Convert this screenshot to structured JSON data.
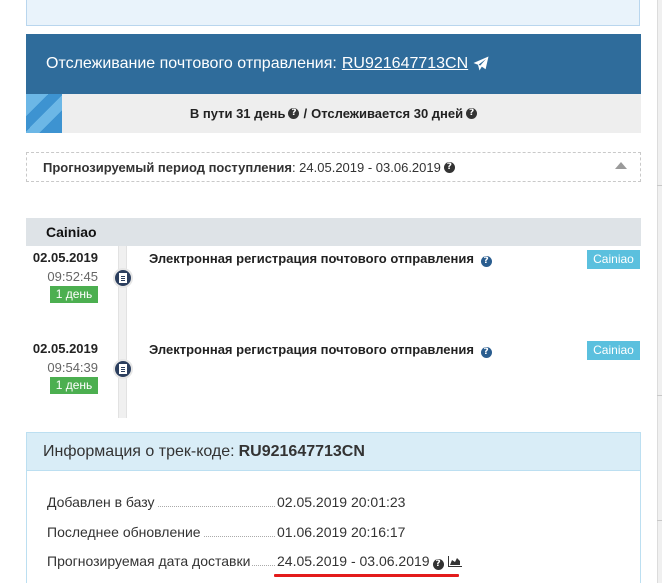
{
  "header": {
    "label": "Отслеживание почтового отправления:",
    "tracking_number": "RU921647713CN"
  },
  "transit": {
    "in_transit": "В пути 31 день",
    "separator": "/",
    "tracked": "Отслеживается 30 дней"
  },
  "forecast": {
    "label": "Прогнозируемый период поступления",
    "value": ": 24.05.2019 - 03.06.2019"
  },
  "carrier": {
    "name": "Cainiao"
  },
  "events": [
    {
      "date": "02.05.2019",
      "time": "09:52:45",
      "days": "1 день",
      "text": "Электронная регистрация почтового отправления",
      "tag": "Cainiao"
    },
    {
      "date": "02.05.2019",
      "time": "09:54:39",
      "days": "1 день",
      "text": "Электронная регистрация почтового отправления",
      "tag": "Cainiao"
    }
  ],
  "info": {
    "title": "Информация о трек-коде:",
    "code": "RU921647713CN",
    "rows": [
      {
        "label": "Добавлен в базу",
        "value": "02.05.2019 20:01:23"
      },
      {
        "label": "Последнее обновление",
        "value": "01.06.2019 20:16:17"
      },
      {
        "label": "Прогнозируемая дата доставки",
        "value": "24.05.2019 - 03.06.2019"
      }
    ]
  },
  "colors": {
    "header_bg": "#2f6c9b",
    "days_badge": "#4caf50",
    "carrier_tag": "#5bc0de",
    "highlight_underline": "#e31b1b"
  },
  "icons": {
    "share": "paper-plane-icon",
    "help": "question-circle-icon",
    "event": "document-icon",
    "chart": "area-chart-icon",
    "collapse": "caret-up-icon"
  }
}
